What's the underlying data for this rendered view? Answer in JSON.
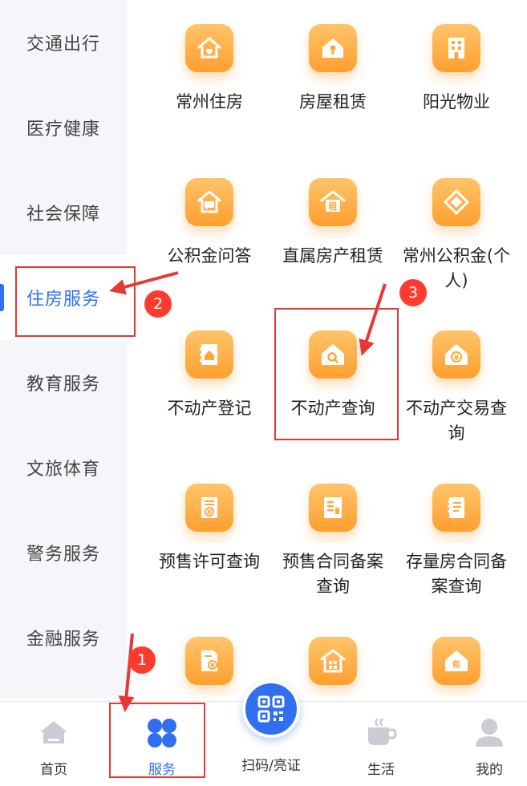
{
  "sidebar": {
    "items": [
      {
        "label": "交通出行"
      },
      {
        "label": "医疗健康"
      },
      {
        "label": "社会保障"
      },
      {
        "label": "住房服务",
        "active": true
      },
      {
        "label": "教育服务"
      },
      {
        "label": "文旅体育"
      },
      {
        "label": "警务服务"
      },
      {
        "label": "金融服务"
      }
    ]
  },
  "grid": {
    "items": [
      {
        "label": "常州住房",
        "icon": "house-heart-icon"
      },
      {
        "label": "房屋租赁",
        "icon": "house-key-icon"
      },
      {
        "label": "阳光物业",
        "icon": "building-icon"
      },
      {
        "label": "公积金问答",
        "icon": "house-chat-icon"
      },
      {
        "label": "直属房产租赁",
        "icon": "house-rent-icon"
      },
      {
        "label": "常州公积金(个人)",
        "icon": "fund-diamond-icon"
      },
      {
        "label": "不动产登记",
        "icon": "property-register-icon"
      },
      {
        "label": "不动产查询",
        "icon": "house-search-icon"
      },
      {
        "label": "不动产交易查询",
        "icon": "house-yuan-icon"
      },
      {
        "label": "预售许可查询",
        "icon": "permit-yuan-icon"
      },
      {
        "label": "预售合同备案查询",
        "icon": "contract-icon"
      },
      {
        "label": "存量房合同备案查询",
        "icon": "notebook-icon"
      },
      {
        "label": "",
        "icon": "document-yuan-icon"
      },
      {
        "label": "",
        "icon": "house-grid-icon"
      },
      {
        "label": "",
        "icon": "house-rent-small-icon"
      }
    ]
  },
  "bottom_nav": {
    "items": [
      {
        "label": "首页",
        "icon": "home-icon"
      },
      {
        "label": "服务",
        "icon": "services-icon",
        "active": true
      },
      {
        "label": "扫码/亮证",
        "icon": "qr-code-icon"
      },
      {
        "label": "生活",
        "icon": "coffee-cup-icon"
      },
      {
        "label": "我的",
        "icon": "user-icon"
      }
    ]
  },
  "annotations": {
    "badges": [
      "1",
      "2",
      "3"
    ]
  },
  "colors": {
    "accent": "#2f6ff0",
    "icon_orange": "#ff9f2e",
    "annotation_red": "#e53935"
  }
}
